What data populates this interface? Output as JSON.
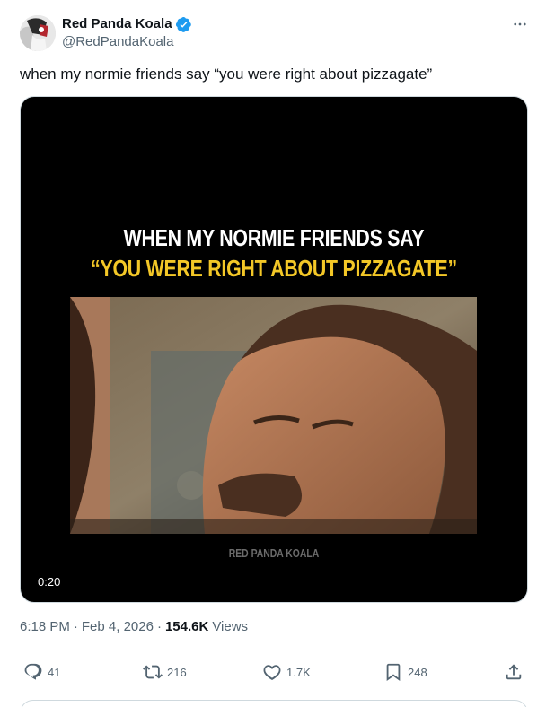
{
  "author": {
    "display_name": "Red Panda Koala",
    "handle": "@RedPandaKoala",
    "verified": true
  },
  "tweet": {
    "text": "when my normie friends say “you were right about pizzagate”"
  },
  "media": {
    "caption_line1": "WHEN MY NORMIE FRIENDS SAY",
    "caption_line2": "“YOU WERE RIGHT ABOUT PIZZAGATE”",
    "watermark": "RED PANDA KOALA",
    "duration": "0:20"
  },
  "meta": {
    "time": "6:18 PM",
    "separator": "·",
    "date": "Feb 4, 2026",
    "views_count": "154.6K",
    "views_label": "Views"
  },
  "actions": {
    "replies": "41",
    "reposts": "216",
    "likes": "1.7K",
    "bookmarks": "248"
  },
  "colors": {
    "verified_blue": "#1d9bf0",
    "caption_yellow": "#f3c727",
    "secondary_text": "#536471"
  },
  "icons": [
    "verified-badge-icon",
    "more-icon",
    "reply-icon",
    "repost-icon",
    "like-icon",
    "bookmark-icon",
    "share-icon"
  ]
}
